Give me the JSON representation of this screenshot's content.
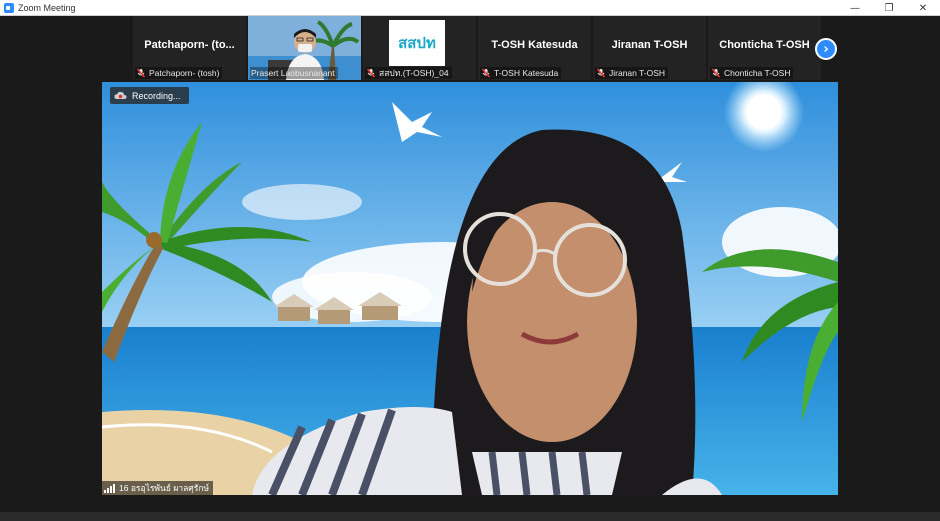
{
  "window": {
    "title": "Zoom Meeting",
    "minimize": "—",
    "restore": "❐",
    "close": "✕"
  },
  "strip": {
    "tiles": [
      {
        "display_name": "Patchaporn-  (to...",
        "label": "Patchaporn- (tosh)",
        "muted": true
      },
      {
        "display_name": "",
        "label": "Prasert Laobusnanant",
        "muted": false,
        "has_video": true
      },
      {
        "display_name": "",
        "label": "สสปท.(T-OSH)_04",
        "muted": true,
        "logo_text": "สสปท"
      },
      {
        "display_name": "T-OSH Katesuda",
        "label": "T-OSH Katesuda",
        "muted": true
      },
      {
        "display_name": "Jiranan T-OSH",
        "label": "Jiranan T-OSH",
        "muted": true
      },
      {
        "display_name": "Chonticha T-OSH",
        "label": "Chonticha T-OSH",
        "muted": true
      }
    ],
    "next_icon": "›"
  },
  "main": {
    "recording_label": "Recording...",
    "speaker_label": "16 อรอุไรพันธ์ ผาลศุรักษ์",
    "colors": {
      "sky": "#4aa8e6",
      "sea": "#1f8fd6",
      "sand": "#e9d2a6"
    }
  }
}
